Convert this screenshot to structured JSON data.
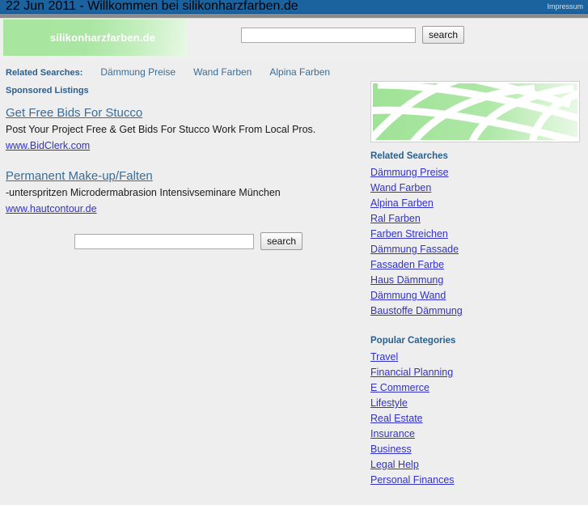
{
  "topbar": {
    "title": "22 Jun 2011 - Willkommen bei silikonharzfarben.de",
    "impressum_label": "Impressum",
    "background_color": "#1b639e"
  },
  "header": {
    "logo_text": "silikonharzfarben.de",
    "logo_color": "#a8e6a0",
    "search": {
      "value": "",
      "placeholder": "",
      "button_label": "search"
    }
  },
  "related_strip": {
    "label": "Related Searches:",
    "links": [
      "Dämmung Preise",
      "Wand Farben",
      "Alpina Farben"
    ]
  },
  "sponsored": {
    "label": "Sponsored Listings",
    "ads": [
      {
        "title": "Get Free Bids For Stucco",
        "description": "Post Your Project Free & Get Bids For Stucco Work From Local Pros.",
        "url": "www.BidClerk.com"
      },
      {
        "title": "Permanent Make-up/Falten",
        "description": "-unterspritzen Microdermabrasion Intensivseminare München",
        "url": "www.hautcontour.de"
      }
    ],
    "search": {
      "value": "",
      "placeholder": "",
      "button_label": "search"
    }
  },
  "sidebar": {
    "banner": {
      "icon": "globe-grid-banner",
      "color": "#a8e6a0"
    },
    "related_searches": {
      "heading": "Related Searches",
      "items": [
        "Dämmung Preise",
        "Wand Farben",
        "Alpina Farben",
        "Ral Farben",
        "Farben Streichen",
        "Dämmung Fassade",
        "Fassaden Farbe",
        "Haus Dämmung",
        "Dämmung Wand",
        "Baustoffe Dämmung"
      ]
    },
    "popular_categories": {
      "heading": "Popular Categories",
      "items": [
        "Travel",
        "Financial Planning",
        "E Commerce",
        "Lifestyle",
        "Real Estate",
        "Insurance",
        "Business",
        "Legal Help",
        "Personal Finances"
      ]
    }
  }
}
